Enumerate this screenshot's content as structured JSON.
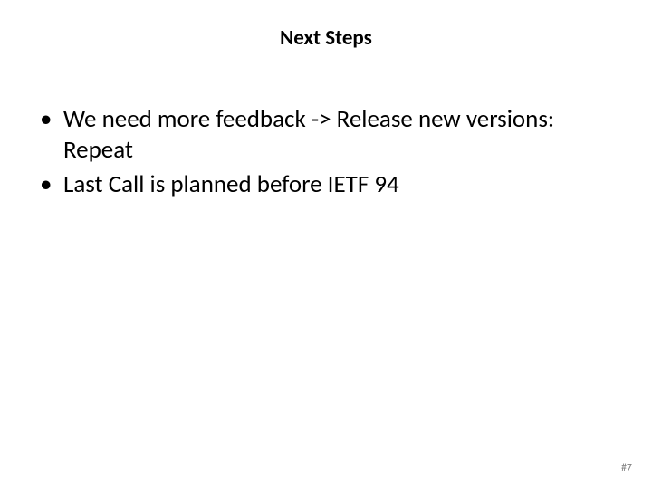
{
  "slide": {
    "title": "Next Steps",
    "bullets": [
      "We need more feedback -> Release new versions: Repeat",
      "Last Call is planned before IETF 94"
    ],
    "footer": "#7"
  }
}
